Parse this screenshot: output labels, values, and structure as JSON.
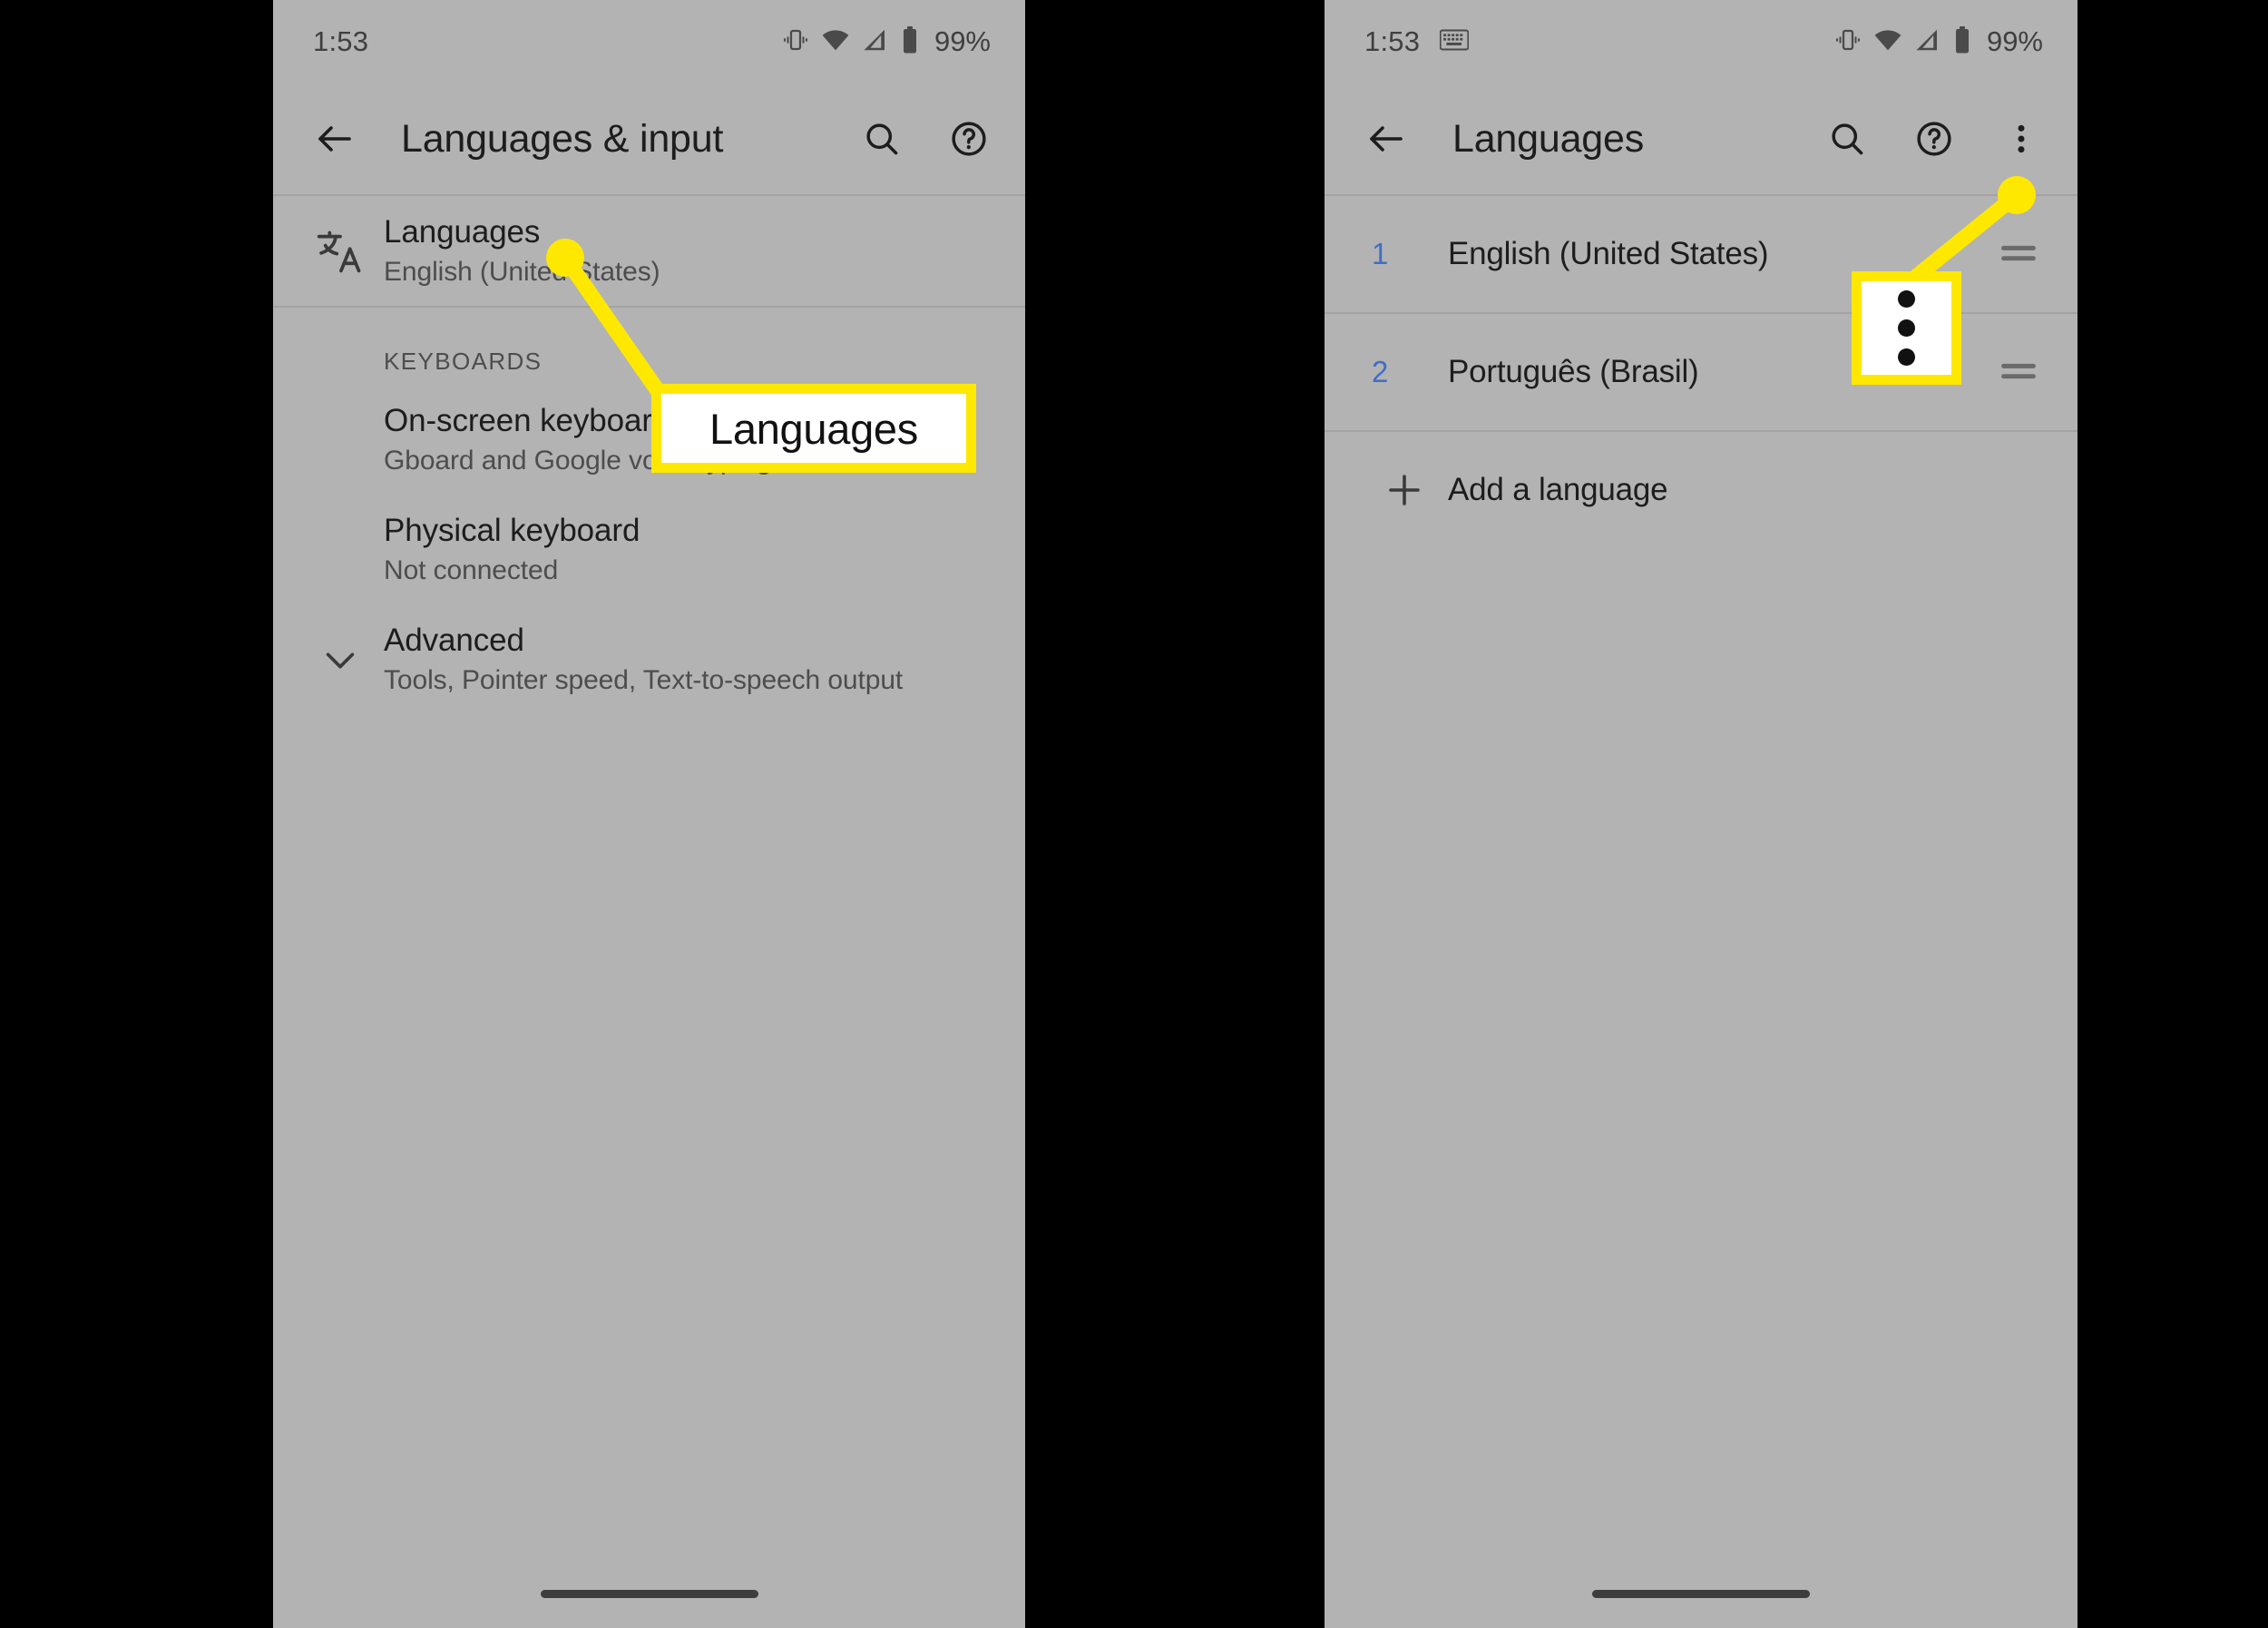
{
  "meta": {
    "accent_yellow": "#ffe800",
    "panel_bg": "#b3b3b3",
    "backdrop": "#000000",
    "link_blue": "#3f6ec4"
  },
  "left_phone": {
    "status_bar": {
      "time": "1:53",
      "battery_percent": "99%",
      "icons": [
        "vibrate-icon",
        "wifi-icon",
        "signal-icon",
        "battery-icon"
      ]
    },
    "app_bar": {
      "back_label": "back-arrow-icon",
      "title": "Languages & input",
      "actions": [
        "search-icon",
        "help-icon"
      ]
    },
    "languages_row": {
      "icon": "translate-icon",
      "title": "Languages",
      "subtitle": "English (United States)"
    },
    "keyboards_section_label": "KEYBOARDS",
    "rows": [
      {
        "title": "On-screen keyboard",
        "subtitle": "Gboard and Google voice typing",
        "icon": ""
      },
      {
        "title": "Physical keyboard",
        "subtitle": "Not connected",
        "icon": ""
      },
      {
        "title": "Advanced",
        "subtitle": "Tools, Pointer speed, Text-to-speech output",
        "icon": "chevron-down-icon"
      }
    ]
  },
  "right_phone": {
    "status_bar": {
      "time": "1:53",
      "battery_percent": "99%",
      "left_icons": [
        "keyboard-icon"
      ],
      "icons": [
        "vibrate-icon",
        "wifi-icon",
        "signal-icon",
        "battery-icon"
      ]
    },
    "app_bar": {
      "back_label": "back-arrow-icon",
      "title": "Languages",
      "actions": [
        "search-icon",
        "help-icon",
        "overflow-menu-icon"
      ]
    },
    "language_list": [
      {
        "number": "1",
        "label": "English (United States)",
        "handle": "drag-handle-icon"
      },
      {
        "number": "2",
        "label": "Português (Brasil)",
        "handle": "drag-handle-icon"
      }
    ],
    "add_language": {
      "icon": "plus-icon",
      "label": "Add a language"
    }
  },
  "annotations": {
    "languages_callout": "Languages",
    "kebab_callout": "overflow-menu-icon"
  }
}
